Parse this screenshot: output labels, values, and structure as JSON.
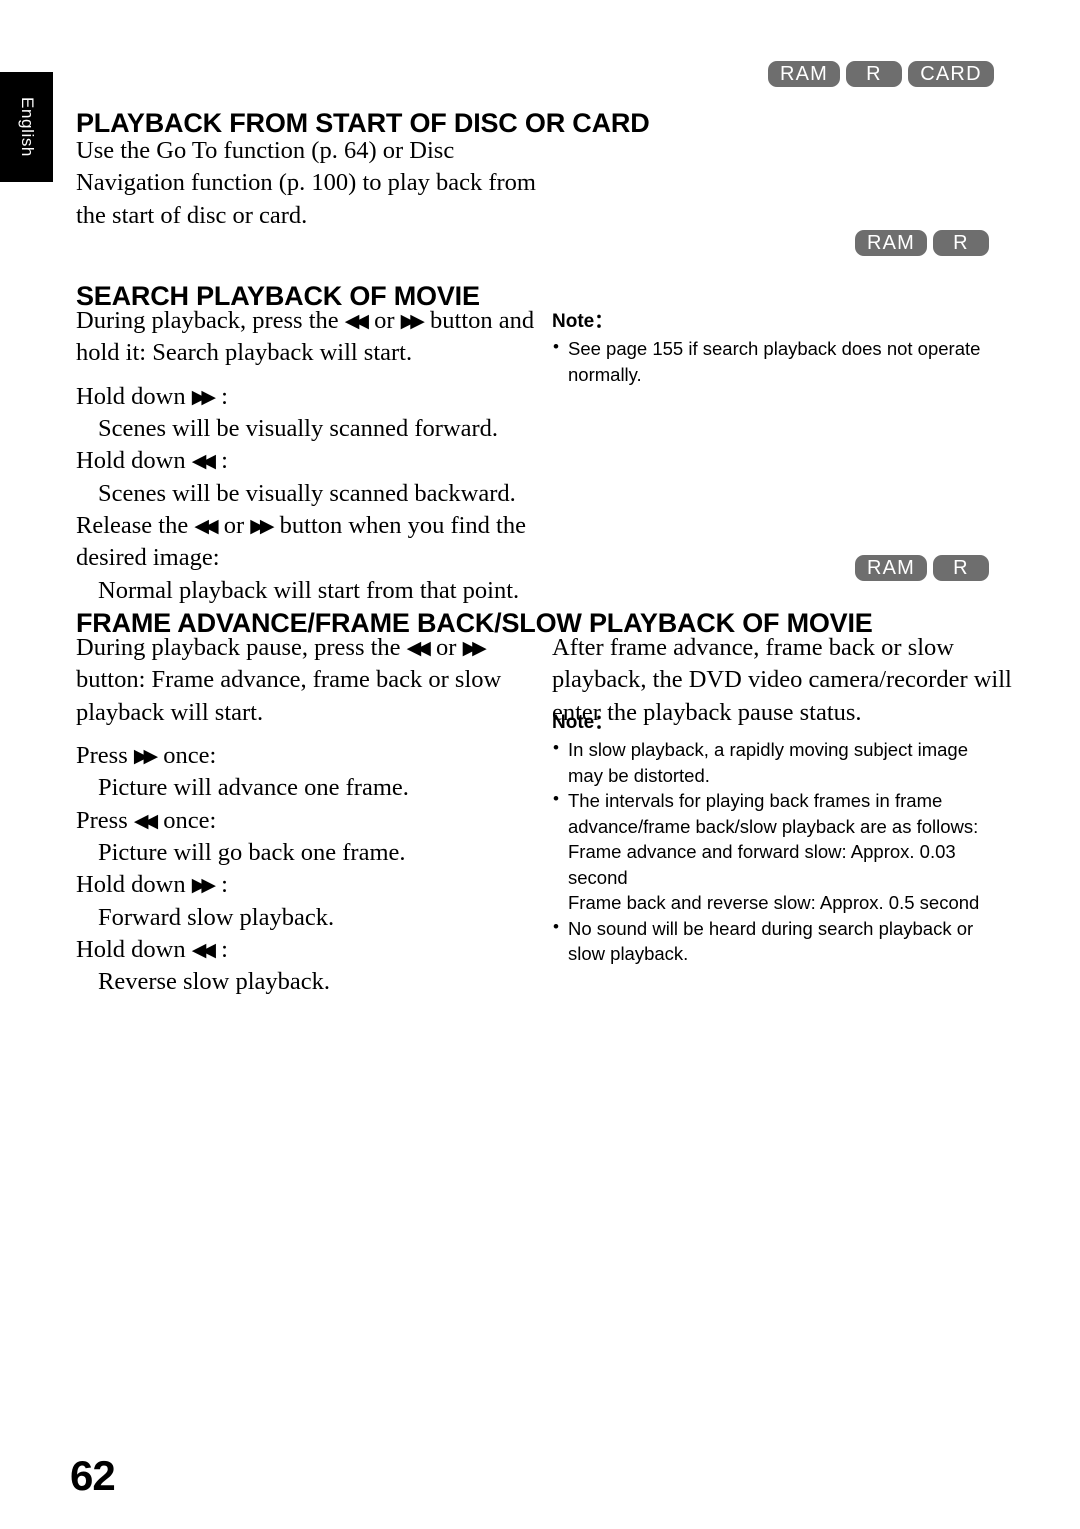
{
  "page": {
    "language_tab": "English",
    "page_number": "62",
    "badge_color": "#6e6e6e",
    "text_color": "#000000",
    "background_color": "#ffffff"
  },
  "icons": {
    "rewind": "◀◀",
    "fast_forward": "▶▶"
  },
  "sections": [
    {
      "id": "playback-from-start",
      "badges": [
        "RAM",
        "R",
        "CARD"
      ],
      "heading": "PLAYBACK FROM START OF DISC OR CARD",
      "body_lines": [
        "Use the Go To function (p. 64) or Disc",
        "Navigation function (p. 100) to play back from",
        "the start of disc or card."
      ]
    },
    {
      "id": "search-playback-of-movie",
      "badges": [
        "RAM",
        "R"
      ],
      "heading": "SEARCH PLAYBACK OF MOVIE",
      "intro_a": "During playback, press the ",
      "intro_b": " or ",
      "intro_c": " button and hold it: Search playback will start.",
      "steps": [
        {
          "label_pre": "Hold down ",
          "icon": "fast_forward",
          "label_post": " :",
          "detail": "Scenes will be visually scanned forward."
        },
        {
          "label_pre": "Hold down ",
          "icon": "rewind",
          "label_post": " :",
          "detail": "Scenes will be visually scanned backward."
        },
        {
          "label_pre": "Release the ",
          "icon": "both",
          "label_post": " button when you find the desired image:",
          "detail": "Normal playback will start from that point."
        }
      ],
      "note": {
        "title": "Note：",
        "items": [
          {
            "text": "See page 155 if search playback does not operate normally.",
            "sub": []
          }
        ]
      }
    },
    {
      "id": "frame-advance-frame-back-slow-playback",
      "badges": [
        "RAM",
        "R"
      ],
      "heading": "FRAME ADVANCE/FRAME BACK/SLOW PLAYBACK OF MOVIE",
      "intro_a": "During playback pause, press the ",
      "intro_b": " or ",
      "intro_c": " button: Frame advance, frame back or slow playback will start.",
      "steps": [
        {
          "label_pre": "Press ",
          "icon": "fast_forward",
          "label_post": " once:",
          "detail": "Picture will advance one frame."
        },
        {
          "label_pre": "Press ",
          "icon": "rewind",
          "label_post": " once:",
          "detail": "Picture will go back one frame."
        },
        {
          "label_pre": "Hold down ",
          "icon": "fast_forward",
          "label_post": " :",
          "detail": "Forward slow playback."
        },
        {
          "label_pre": "Hold down ",
          "icon": "rewind",
          "label_post": " :",
          "detail": "Reverse slow playback."
        }
      ],
      "right_paragraph": "After frame advance, frame back or slow playback, the DVD video camera/recorder will enter the playback pause status.",
      "note": {
        "title": "Note：",
        "items": [
          {
            "text": "In slow playback, a rapidly moving subject image may be distorted.",
            "sub": []
          },
          {
            "text": "The intervals for playing back frames in frame advance/frame back/slow playback are as follows:",
            "sub": [
              "Frame advance and forward slow: Approx. 0.03 second",
              "Frame back and reverse slow: Approx. 0.5 second"
            ]
          },
          {
            "text": "No sound will be heard during search playback or slow playback.",
            "sub": []
          }
        ]
      }
    }
  ]
}
